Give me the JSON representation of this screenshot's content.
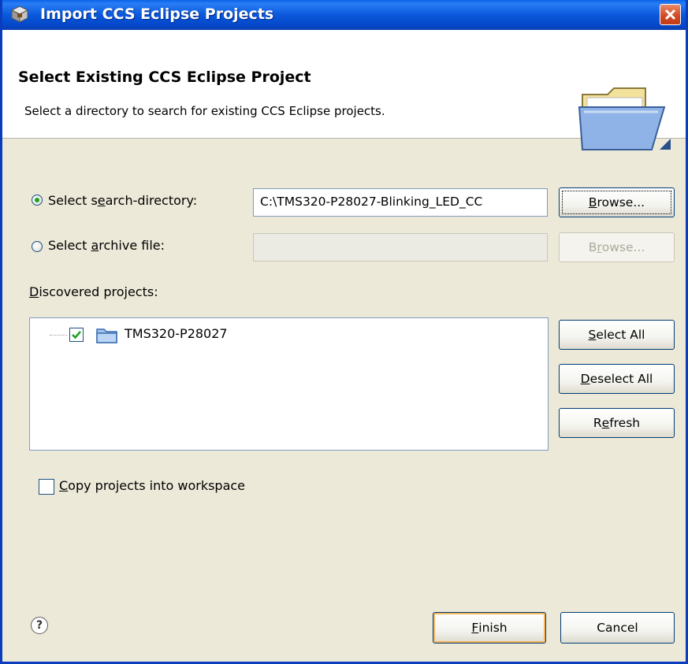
{
  "window": {
    "title": "Import CCS Eclipse Projects"
  },
  "banner": {
    "title": "Select Existing CCS Eclipse Project",
    "description": "Select a directory to search for existing CCS Eclipse projects.",
    "icon": "open-folder-icon"
  },
  "source": {
    "search_dir_label_pre": "Select s",
    "search_dir_label_key": "e",
    "search_dir_label_post": "arch-directory:",
    "search_dir_selected": true,
    "search_dir_value": "C:\\TMS320-P28027-Blinking_LED_CC",
    "browse1_pre": "",
    "browse1_key": "B",
    "browse1_post": "rowse...",
    "archive_label_pre": "Select ",
    "archive_label_key": "a",
    "archive_label_post": "rchive file:",
    "archive_selected": false,
    "archive_value": "",
    "browse2_pre": "B",
    "browse2_key": "r",
    "browse2_post": "owse..."
  },
  "projects": {
    "label_key": "D",
    "label_post": "iscovered projects:",
    "items": [
      {
        "name": "TMS320-P28027",
        "checked": true,
        "icon": "project-folder-icon"
      }
    ],
    "select_all_pre": "",
    "select_all_key": "S",
    "select_all_post": "elect All",
    "deselect_all_pre": "",
    "deselect_all_key": "D",
    "deselect_all_post": "eselect All",
    "refresh_pre": "R",
    "refresh_key": "e",
    "refresh_post": "fresh"
  },
  "options": {
    "copy_key": "C",
    "copy_post": "opy projects into workspace",
    "copy_checked": false
  },
  "footer": {
    "help_icon": "question-mark",
    "finish_key": "F",
    "finish_post": "inish",
    "cancel_label": "Cancel"
  },
  "colors": {
    "titlebar": "#0a58dc",
    "dialog_bg": "#ece9d8",
    "check_green": "#21a121"
  }
}
